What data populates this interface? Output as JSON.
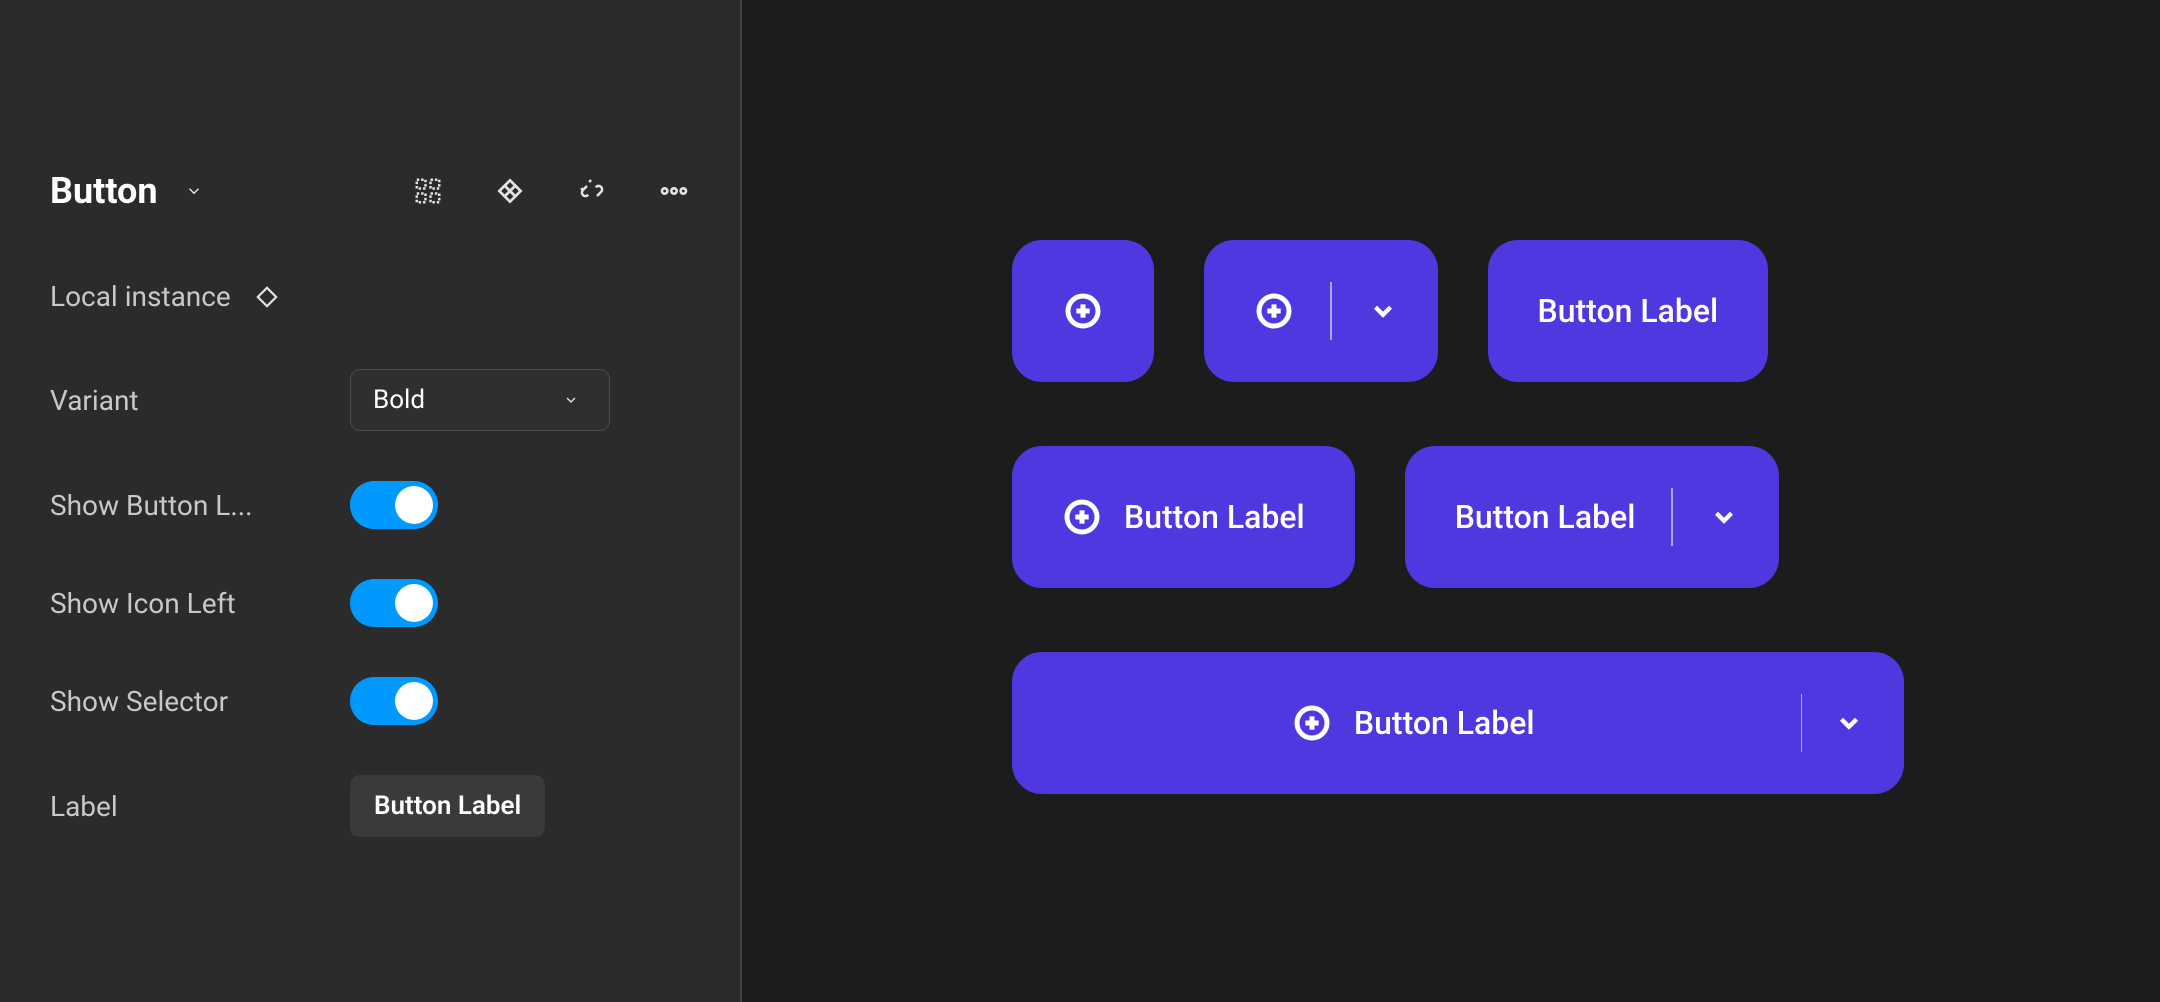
{
  "panel": {
    "title": "Button",
    "local_instance_label": "Local instance",
    "rows": {
      "variant": {
        "label": "Variant",
        "value": "Bold"
      },
      "show_button_label": {
        "label": "Show Button L...",
        "value": true
      },
      "show_icon_left": {
        "label": "Show Icon Left",
        "value": true
      },
      "show_selector": {
        "label": "Show Selector",
        "value": true
      },
      "label_field": {
        "label": "Label",
        "value": "Button Label"
      }
    }
  },
  "canvas": {
    "buttons": {
      "b1_label": "",
      "b2_label": "",
      "b3_label": "Button Label",
      "b4_label": "Button Label",
      "b5_label": "Button Label",
      "b6_label": "Button Label"
    }
  },
  "colors": {
    "button_bg": "#5038e0",
    "toggle_on": "#0099ff",
    "panel_bg": "#2b2b2b",
    "canvas_bg": "#1c1c1c"
  }
}
